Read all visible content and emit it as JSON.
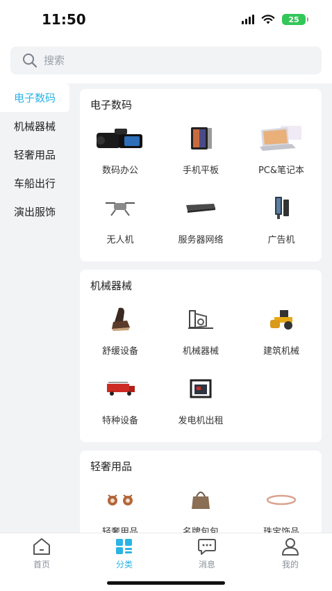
{
  "status_bar": {
    "time": "11:50",
    "battery": "25"
  },
  "search": {
    "placeholder": "搜索"
  },
  "sidebar": {
    "items": [
      {
        "label": "电子数码",
        "active": true
      },
      {
        "label": "机械器械"
      },
      {
        "label": "轻奢用品"
      },
      {
        "label": "车船出行"
      },
      {
        "label": "演出服饰"
      }
    ]
  },
  "sections": [
    {
      "title": "电子数码",
      "items": [
        {
          "label": "数码办公",
          "icon": "camera-icon"
        },
        {
          "label": "手机平板",
          "icon": "tablet-icon"
        },
        {
          "label": "PC&笔记本",
          "icon": "laptop-icon"
        },
        {
          "label": "无人机",
          "icon": "drone-icon"
        },
        {
          "label": "服务器网络",
          "icon": "server-icon"
        },
        {
          "label": "广告机",
          "icon": "ad-display-icon"
        }
      ]
    },
    {
      "title": "机械器械",
      "items": [
        {
          "label": "舒缓设备",
          "icon": "massage-chair-icon"
        },
        {
          "label": "机械器械",
          "icon": "machine-icon"
        },
        {
          "label": "建筑机械",
          "icon": "road-roller-icon"
        },
        {
          "label": "特种设备",
          "icon": "fire-truck-icon"
        },
        {
          "label": "发电机出租",
          "icon": "generator-icon"
        }
      ]
    },
    {
      "title": "轻奢用品",
      "items": [
        {
          "label": "轻奢用品",
          "icon": "earrings-icon"
        },
        {
          "label": "名牌包包",
          "icon": "handbag-icon"
        },
        {
          "label": "珠宝饰品",
          "icon": "bracelet-icon"
        }
      ]
    }
  ],
  "tabbar": {
    "tabs": [
      {
        "label": "首页",
        "icon": "home-icon"
      },
      {
        "label": "分类",
        "icon": "category-icon",
        "active": true
      },
      {
        "label": "消息",
        "icon": "message-icon"
      },
      {
        "label": "我的",
        "icon": "profile-icon"
      }
    ]
  },
  "colors": {
    "accent": "#2bb3e6",
    "background": "#f2f3f5",
    "battery": "#33c759"
  }
}
